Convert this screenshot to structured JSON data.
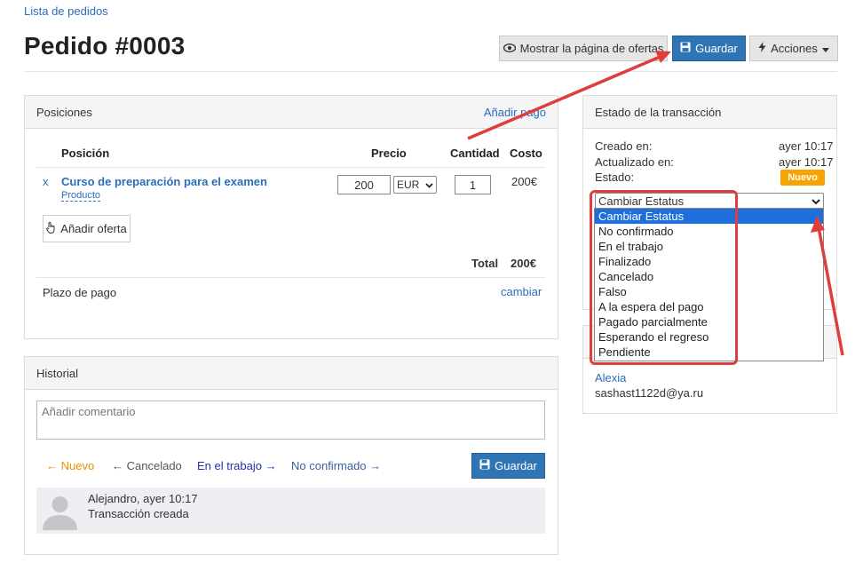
{
  "breadcrumb": "Lista de pedidos",
  "page_title": "Pedido #0003",
  "toolbar": {
    "show_offers_label": "Mostrar la página de ofertas",
    "save_label": "Guardar",
    "actions_label": "Acciones"
  },
  "positions": {
    "title": "Posiciones",
    "add_payment_link": "Añadir pago",
    "columns": {
      "position": "Posición",
      "price": "Precio",
      "quantity": "Cantidad",
      "cost": "Costo"
    },
    "items": [
      {
        "remove": "x",
        "name": "Curso de preparación para el examen",
        "type": "Producto",
        "price": "200",
        "currency": "EUR",
        "quantity": "1",
        "cost": "200€"
      }
    ],
    "add_offer_label": "Añadir oferta",
    "total_label": "Total",
    "total_value": "200€",
    "payment_term_label": "Plazo de pago",
    "change_link": "cambiar"
  },
  "transaction": {
    "title": "Estado de la transacción",
    "created_label": "Creado en:",
    "created_value": "ayer 10:17",
    "updated_label": "Actualizado en:",
    "updated_value": "ayer 10:17",
    "status_label": "Estado:",
    "status_badge": "Nuevo",
    "status_select_value": "Cambiar Estatus",
    "status_options": [
      "Cambiar Estatus",
      "No confirmado",
      "En el trabajo",
      "Finalizado",
      "Cancelado",
      "Falso",
      "A la espera del pago",
      "Pagado parcialmente",
      "Esperando el regreso",
      "Pendiente"
    ]
  },
  "customer": {
    "name": "Alexia",
    "email": "sashast1122d@ya.ru"
  },
  "history": {
    "title": "Historial",
    "comment_placeholder": "Añadir comentario",
    "links": {
      "nuevo": "Nuevo",
      "cancelado": "Cancelado",
      "en_trabajo": "En el trabajo",
      "no_confirmado": "No confirmado"
    },
    "save_label": "Guardar",
    "entry_author": "Alejandro, ayer 10:17",
    "entry_text": "Transacción creada"
  },
  "colors": {
    "primary": "#2f75b5",
    "link": "#2a6ebb",
    "badge_new": "#f7a300",
    "annotation": "#e03e3e",
    "history_nuevo": "#f28c00"
  }
}
